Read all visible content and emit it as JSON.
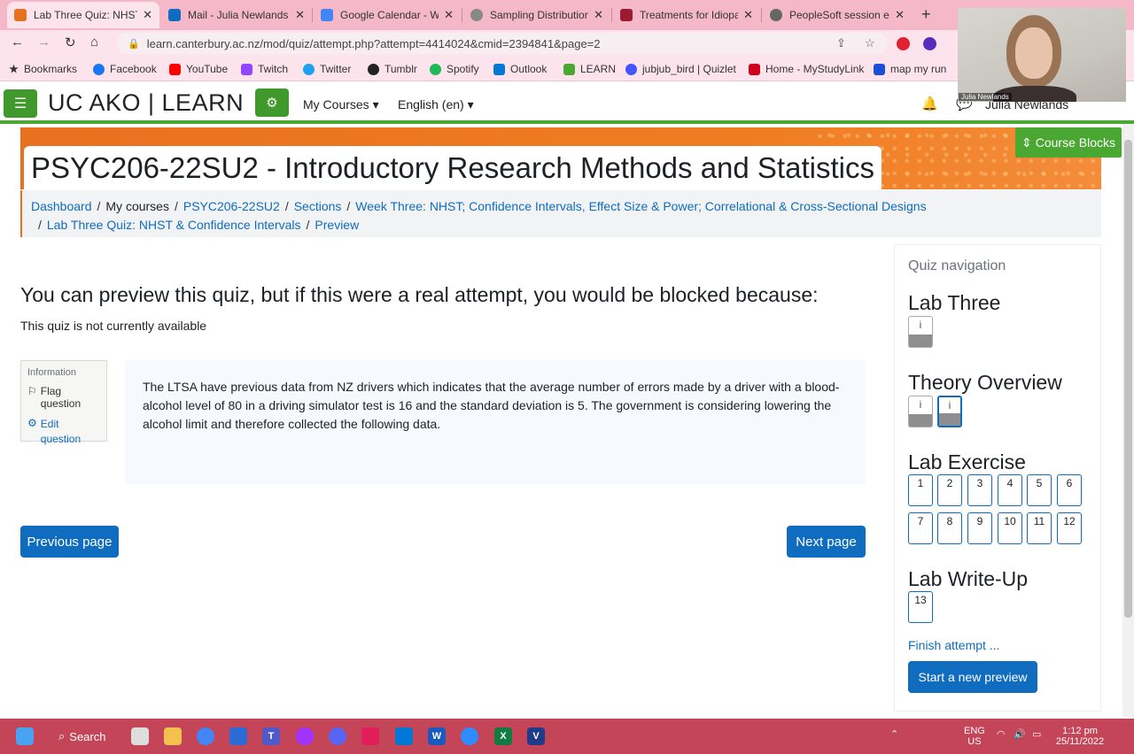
{
  "browser": {
    "tabs": [
      {
        "label": "Lab Three Quiz: NHST",
        "color": "#e8711f",
        "active": true
      },
      {
        "label": "Mail - Julia Newlands",
        "color": "#0f6cbf"
      },
      {
        "label": "Google Calendar - We",
        "color": "#4285f4"
      },
      {
        "label": "Sampling Distribution",
        "color": "#666666"
      },
      {
        "label": "Treatments for Idiopa",
        "color": "#9b1b30"
      },
      {
        "label": "PeopleSoft session ex",
        "color": "#555555"
      }
    ],
    "url": "learn.canterbury.ac.nz/mod/quiz/attempt.php?attempt=4414024&cmid=2394841&page=2",
    "bookmarks": [
      {
        "label": "Bookmarks",
        "color": "#333333"
      },
      {
        "label": "Facebook",
        "color": "#1877f2"
      },
      {
        "label": "YouTube",
        "color": "#ff0000"
      },
      {
        "label": "Twitch",
        "color": "#9146ff"
      },
      {
        "label": "Twitter",
        "color": "#1da1f2"
      },
      {
        "label": "Tumblr",
        "color": "#222222"
      },
      {
        "label": "Spotify",
        "color": "#1db954"
      },
      {
        "label": "Outlook",
        "color": "#0078d4"
      },
      {
        "label": "LEARN",
        "color": "#4aa832"
      },
      {
        "label": "jubjub_bird | Quizlet",
        "color": "#4255ff"
      },
      {
        "label": "Home - MyStudyLink",
        "color": "#d0021b"
      },
      {
        "label": "map my run",
        "color": "#1a4fd6"
      }
    ]
  },
  "navbar": {
    "brand": "UC AKO | LEARN",
    "my_courses": "My Courses",
    "language": "English (en)",
    "account": "Julia Newlands"
  },
  "header": {
    "course_title": "PSYC206-22SU2 - Introductory Research Methods and Statistics",
    "course_blocks": "Course Blocks"
  },
  "breadcrumb": {
    "dashboard": "Dashboard",
    "my_courses": "My courses",
    "course": "PSYC206-22SU2",
    "sections": "Sections",
    "week": "Week Three: NHST; Confidence Intervals, Effect Size & Power; Correlational & Cross-Sectional Designs",
    "quiz": "Lab Three Quiz: NHST & Confidence Intervals",
    "preview": "Preview"
  },
  "main": {
    "blocked_heading": "You can preview this quiz, but if this were a real attempt, you would be blocked because:",
    "not_available": "This quiz is not currently available",
    "info_title": "Information",
    "flag_question": "Flag question",
    "edit_question": "Edit question",
    "question_text": "The LTSA have previous data from NZ drivers which indicates that the average number of errors made by a driver with a blood-alcohol level of 80 in a driving simulator test is 16 and the standard deviation is 5. The government is considering lowering the alcohol limit and therefore collected the following data.",
    "prev_button": "Previous page",
    "next_button": "Next page"
  },
  "quiz_nav": {
    "title": "Quiz navigation",
    "sections": [
      {
        "label": "Lab Three",
        "buttons": [
          "i"
        ]
      },
      {
        "label": "Theory Overview",
        "buttons": [
          "i",
          "i"
        ]
      },
      {
        "label": "Lab Exercise",
        "buttons": [
          "1",
          "2",
          "3",
          "4",
          "5",
          "6",
          "7",
          "8",
          "9",
          "10",
          "11",
          "12"
        ]
      },
      {
        "label": "Lab Write-Up",
        "buttons": [
          "13"
        ]
      }
    ],
    "finish": "Finish attempt ...",
    "start_new": "Start a new preview"
  },
  "webcam_label": "Julia Newlands",
  "taskbar": {
    "search": "Search",
    "lang_top": "ENG",
    "lang_bottom": "US",
    "time": "1:12 pm",
    "date": "25/11/2022"
  }
}
